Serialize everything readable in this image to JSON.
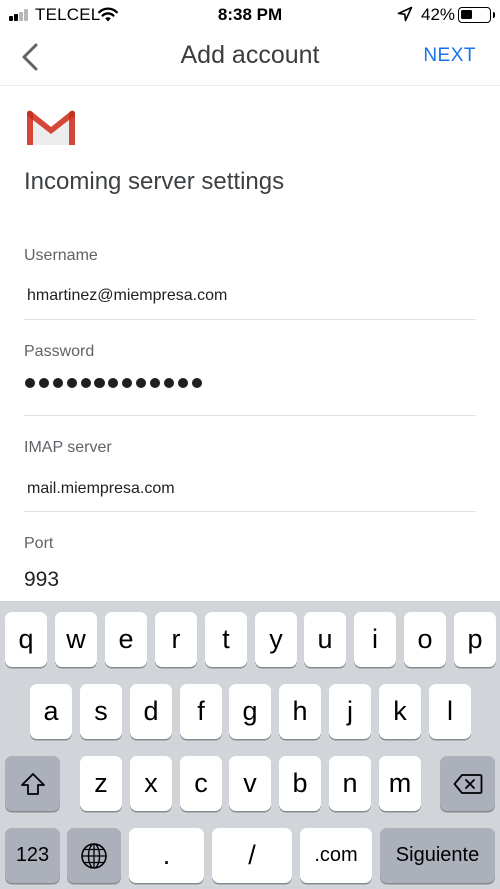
{
  "status_bar": {
    "carrier": "TELCEL",
    "time": "8:38 PM",
    "battery": "42%",
    "battery_level": 0.42
  },
  "nav": {
    "title": "Add account",
    "next_label": "NEXT"
  },
  "logo": {
    "icon": "gmail-logo"
  },
  "heading": "Incoming server settings",
  "form": {
    "username": {
      "label": "Username",
      "value": "hmartinez@miempresa.com"
    },
    "password": {
      "label": "Password",
      "masked_length": 13
    },
    "imap_server": {
      "label": "IMAP server",
      "value": "mail.miempresa.com"
    },
    "port": {
      "label": "Port",
      "value": "993"
    }
  },
  "keyboard": {
    "row1": [
      "q",
      "w",
      "e",
      "r",
      "t",
      "y",
      "u",
      "i",
      "o",
      "p"
    ],
    "row2": [
      "a",
      "s",
      "d",
      "f",
      "g",
      "h",
      "j",
      "k",
      "l"
    ],
    "row3": [
      "z",
      "x",
      "c",
      "v",
      "b",
      "n",
      "m"
    ],
    "numbers_key": "123",
    "dot_key": ".",
    "slash_key": "/",
    "dotcom_key": ".com",
    "return_key": "Siguiente",
    "icons": {
      "shift": "shift-icon",
      "delete": "delete-icon",
      "globe": "globe-icon"
    }
  }
}
